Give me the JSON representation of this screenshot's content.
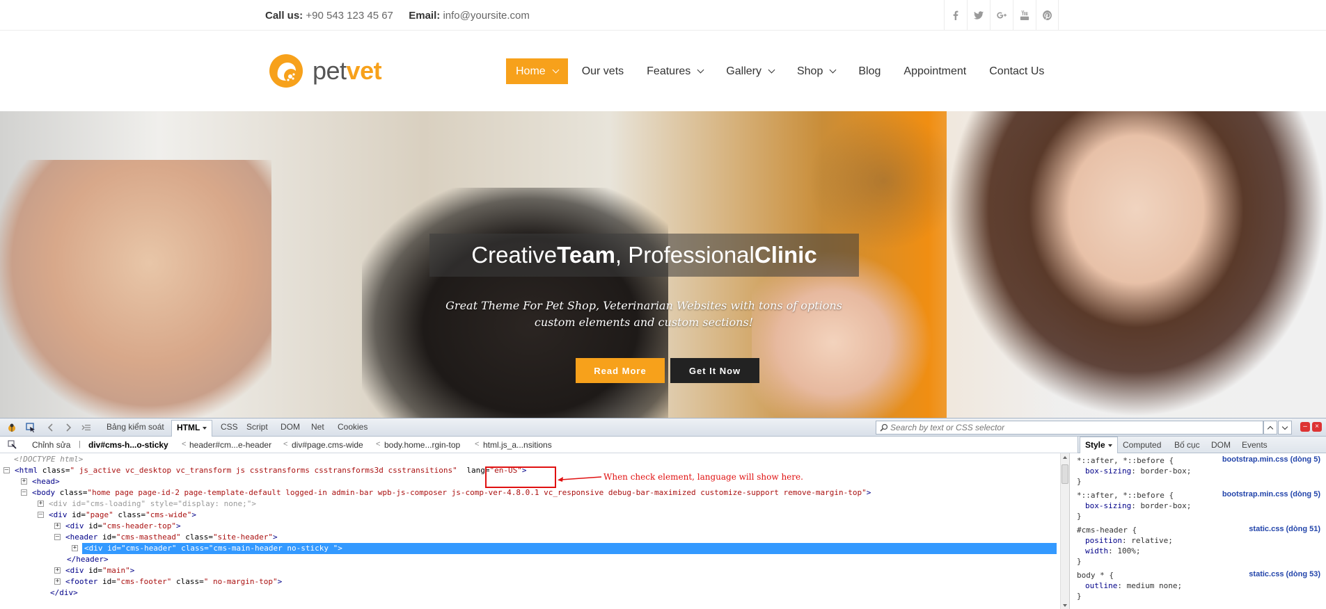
{
  "topbar": {
    "call_label": "Call us:",
    "call_value": "+90 543 123 45 67",
    "email_label": "Email:",
    "email_value": "info@yoursite.com",
    "social": [
      "facebook-icon",
      "twitter-icon",
      "google-plus-icon",
      "youtube-icon",
      "pinterest-icon"
    ]
  },
  "header": {
    "logo_pet": "pet",
    "logo_vet": "vet",
    "nav": [
      {
        "label": "Home",
        "dropdown": true,
        "active": true
      },
      {
        "label": "Our vets",
        "dropdown": false
      },
      {
        "label": "Features",
        "dropdown": true
      },
      {
        "label": "Gallery",
        "dropdown": true
      },
      {
        "label": "Shop",
        "dropdown": true
      },
      {
        "label": "Blog",
        "dropdown": false
      },
      {
        "label": "Appointment",
        "dropdown": false
      },
      {
        "label": "Contact Us",
        "dropdown": false
      }
    ]
  },
  "hero": {
    "title_1": "Creative ",
    "title_2": "Team",
    "title_3": ", Professional ",
    "title_4": "Clinic",
    "subtitle_1": "Great Theme For Pet Shop, Veterinarian Websites with tons of options",
    "subtitle_2": "custom elements and custom sections!",
    "read_more": "Read More",
    "get_it_now": "Get It Now"
  },
  "devtools": {
    "tabs": [
      "Bảng kiểm soát",
      "HTML",
      "CSS",
      "Script",
      "DOM",
      "Net",
      "Cookies"
    ],
    "active_tab": "HTML",
    "search_placeholder": "Search by text or CSS selector",
    "edit_label": "Chỉnh sửa",
    "breadcrumbs": [
      "div#cms-h...o-sticky",
      "header#cm...e-header",
      "div#page.cms-wide",
      "body.home...rgin-top",
      "html.js_a...nsitions"
    ],
    "side_tabs": [
      "Style",
      "Computed",
      "Bố cục",
      "DOM",
      "Events"
    ],
    "annotation": "When check element, language will show here.",
    "html_lines": {
      "doctype": "<!DOCTYPE html>",
      "html_open_a": "<html",
      "html_class_attr": " class=",
      "html_class_val": "\" js_active vc_desktop vc_transform js csstransforms csstransforms3d csstransitions\"",
      "html_lang_attr": " lang=",
      "html_lang_val": "\"en-US\"",
      "html_open_b": ">",
      "head": "<head>",
      "body_open": "<body",
      "body_class_attr": " class=",
      "body_class_val": "\"home page page-id-2 page-template-default logged-in admin-bar wpb-js-composer js-comp-ver-4.8.0.1 vc_responsive debug-bar-maximized customize-support remove-margin-top\"",
      "body_close": ">",
      "loading_text": "<div id=\"cms-loading\" style=\"display: none;\">",
      "page_open": "<div",
      "page_id_attr": " id=",
      "page_id_val": "\"page\"",
      "page_class_attr": " class=",
      "page_class_val": "\"cms-wide\"",
      "page_close": ">",
      "header_top_open": "<div",
      "header_top_id_attr": " id=",
      "header_top_id_val": "\"cms-header-top\"",
      "header_top_close": ">",
      "masthead_open": "<header",
      "masthead_id_attr": " id=",
      "masthead_id_val": "\"cms-masthead\"",
      "masthead_class_attr": " class=",
      "masthead_class_val": "\"site-header\"",
      "masthead_close": ">",
      "cmsheader_text": "<div id=\"cms-header\" class=\"cms-main-header no-sticky \">",
      "header_end": "</header>",
      "main_open": "<div",
      "main_id_attr": " id=",
      "main_id_val": "\"main\"",
      "main_close": ">",
      "footer_open": "<footer",
      "footer_id_attr": " id=",
      "footer_id_val": "\"cms-footer\"",
      "footer_class_attr": " class=",
      "footer_class_val": "\" no-margin-top\"",
      "footer_close": ">",
      "div_end": "</div>"
    },
    "styles": [
      {
        "selector": "*::after, *::before {",
        "source": "bootstrap.min.css (dòng 5)",
        "props": [
          {
            "name": "box-sizing",
            "value": "border-box;"
          }
        ]
      },
      {
        "selector": "*::after, *::before {",
        "source": "bootstrap.min.css (dòng 5)",
        "props": [
          {
            "name": "box-sizing",
            "value": "border-box;"
          }
        ]
      },
      {
        "selector": "#cms-header {",
        "source": "static.css (dòng 51)",
        "props": [
          {
            "name": "position",
            "value": "relative;"
          },
          {
            "name": "width",
            "value": "100%;"
          }
        ]
      },
      {
        "selector": "body * {",
        "source": "static.css (dòng 53)",
        "props": [
          {
            "name": "outline",
            "value": "medium none;"
          }
        ]
      }
    ],
    "close_brace": "}"
  }
}
